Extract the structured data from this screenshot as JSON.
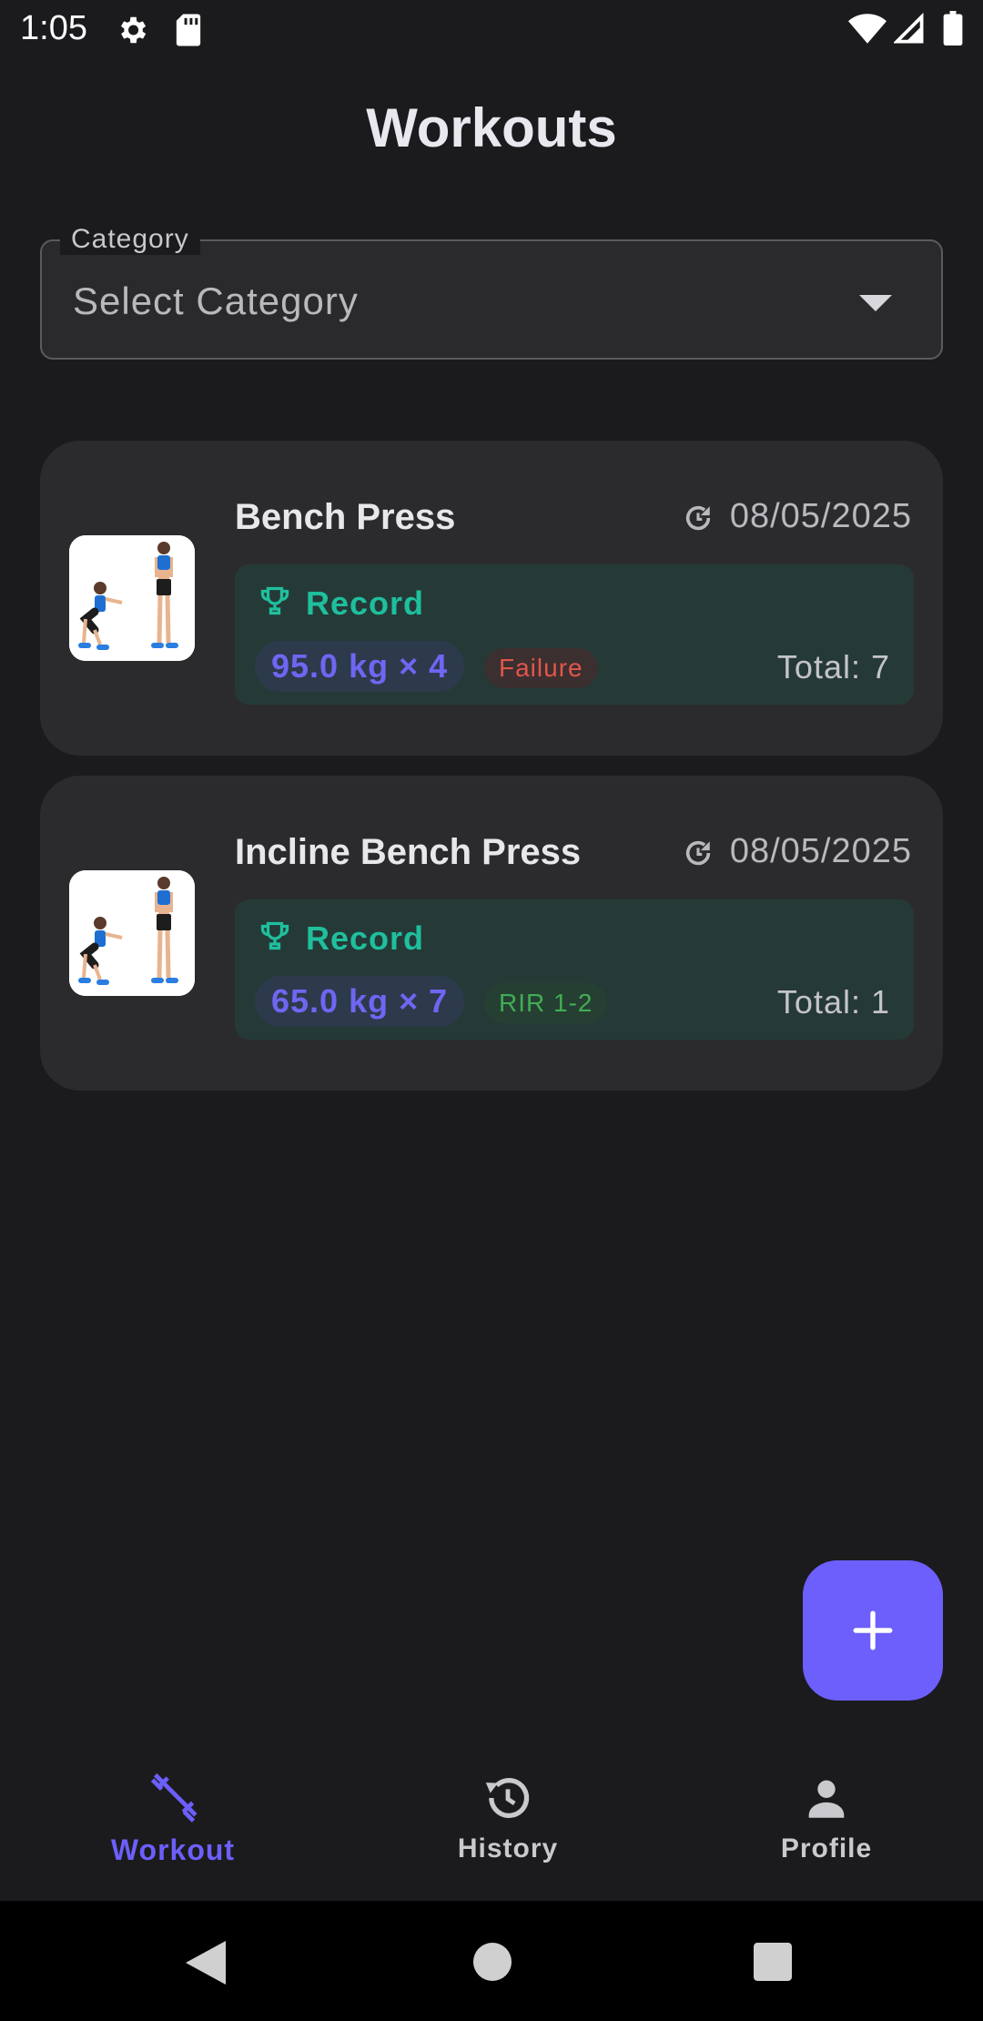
{
  "status_bar": {
    "time": "1:05",
    "icons": [
      "gear-icon",
      "sd-card-icon",
      "wifi-icon",
      "signal-icon",
      "battery-icon"
    ]
  },
  "page": {
    "title": "Workouts"
  },
  "category": {
    "label": "Category",
    "value": "Select Category",
    "icon": "dropdown-arrow-icon"
  },
  "workouts": [
    {
      "name": "Bench Press",
      "date": "08/05/2025",
      "record_label": "Record",
      "record_value": "95.0 kg × 4",
      "intensity": "Failure",
      "total": "Total: 7"
    },
    {
      "name": "Incline Bench Press",
      "date": "08/05/2025",
      "record_label": "Record",
      "record_value": "65.0 kg × 7",
      "intensity": "RIR 1-2",
      "total": "Total: 1"
    }
  ],
  "fab": {
    "icon": "plus-icon"
  },
  "bottom_nav": {
    "items": [
      {
        "label": "Workout",
        "icon": "dumbbell-icon",
        "active": true
      },
      {
        "label": "History",
        "icon": "history-icon",
        "active": false
      },
      {
        "label": "Profile",
        "icon": "person-icon",
        "active": false
      }
    ]
  },
  "colors": {
    "accent": "#6c5ffb",
    "record_green": "#1fbf9d",
    "failure_red": "#e2554b",
    "rir_green": "#3fae53",
    "background": "#1b1b1d",
    "card": "#2b2b2d"
  }
}
